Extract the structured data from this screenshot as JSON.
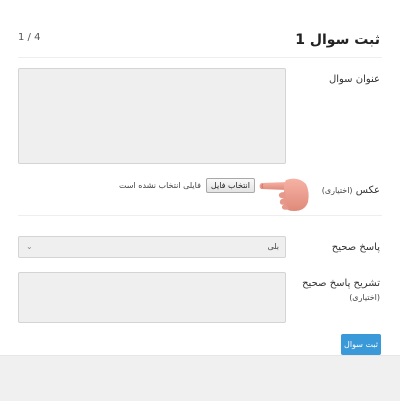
{
  "header": {
    "title": "ثبت سوال 1",
    "pager": "1 / 4"
  },
  "form": {
    "question_title_label": "عنوان سوال",
    "question_title_value": "",
    "image_label": "عکس",
    "image_optional": "(اختیاری)",
    "file_button_label": "انتخاب فایل",
    "file_status": "فایلی انتخاب نشده است",
    "correct_answer_label": "پاسخ صحیح",
    "correct_answer_value": "بلی",
    "explanation_label": "تشریح پاسخ صحیح",
    "explanation_optional": "(اختیاری)",
    "explanation_value": "",
    "submit_label": "ثبت سوال"
  },
  "icons": {
    "pointer": "pointing-hand-icon",
    "dropdown": "chevron-down-icon"
  },
  "colors": {
    "accent": "#3a99d8",
    "field_bg": "#efefef",
    "field_border": "#d4d4d4",
    "footer_bg": "#f0f0f0"
  }
}
